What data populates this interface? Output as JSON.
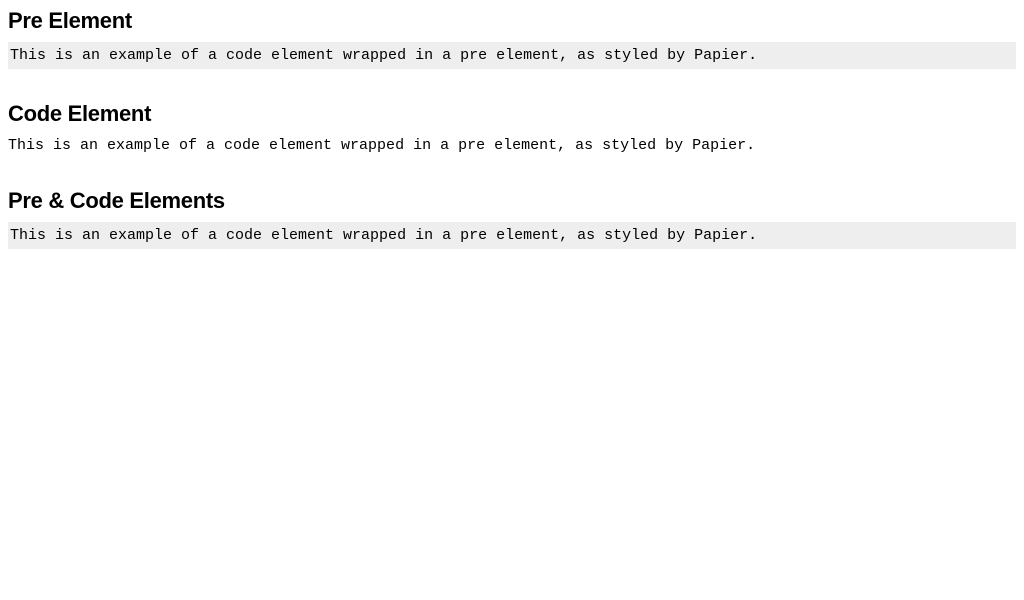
{
  "sections": [
    {
      "heading": "Pre Element",
      "code": "This is an example of a code element wrapped in a pre element, as styled by Papier.",
      "style": "pre"
    },
    {
      "heading": "Code Element",
      "code": "This is an example of a code element wrapped in a pre element, as styled by Papier.",
      "style": "code"
    },
    {
      "heading": "Pre & Code Elements",
      "code": "This is an example of a code element wrapped in a pre element, as styled by Papier.",
      "style": "pre"
    }
  ]
}
